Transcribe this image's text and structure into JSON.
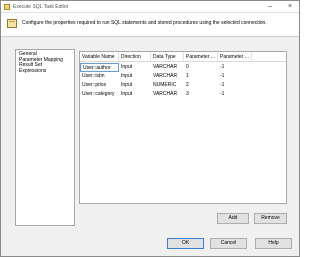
{
  "window": {
    "title": "Execute SQL Task Editor"
  },
  "header": {
    "description": "Configure the properties required to run SQL statements and stored procedures using the selected connection."
  },
  "nav": {
    "items": [
      "General",
      "Parameter Mapping",
      "Result Set",
      "Expressions"
    ]
  },
  "grid": {
    "columns": [
      "Variable Name",
      "Direction",
      "Data Type",
      "Parameter ...",
      "Parameter ..."
    ],
    "rows": [
      [
        "User::author",
        "Input",
        "VARCHAR",
        "0",
        "-1"
      ],
      [
        "User::isbn",
        "Input",
        "VARCHAR",
        "1",
        "-1"
      ],
      [
        "User::price",
        "Input",
        "NUMERIC",
        "2",
        "-1"
      ],
      [
        "User::category",
        "Input",
        "VARCHAR",
        "3",
        "-1"
      ]
    ]
  },
  "buttons": {
    "add": "Add",
    "remove": "Remove",
    "ok": "OK",
    "cancel": "Cancel",
    "help": "Help"
  }
}
